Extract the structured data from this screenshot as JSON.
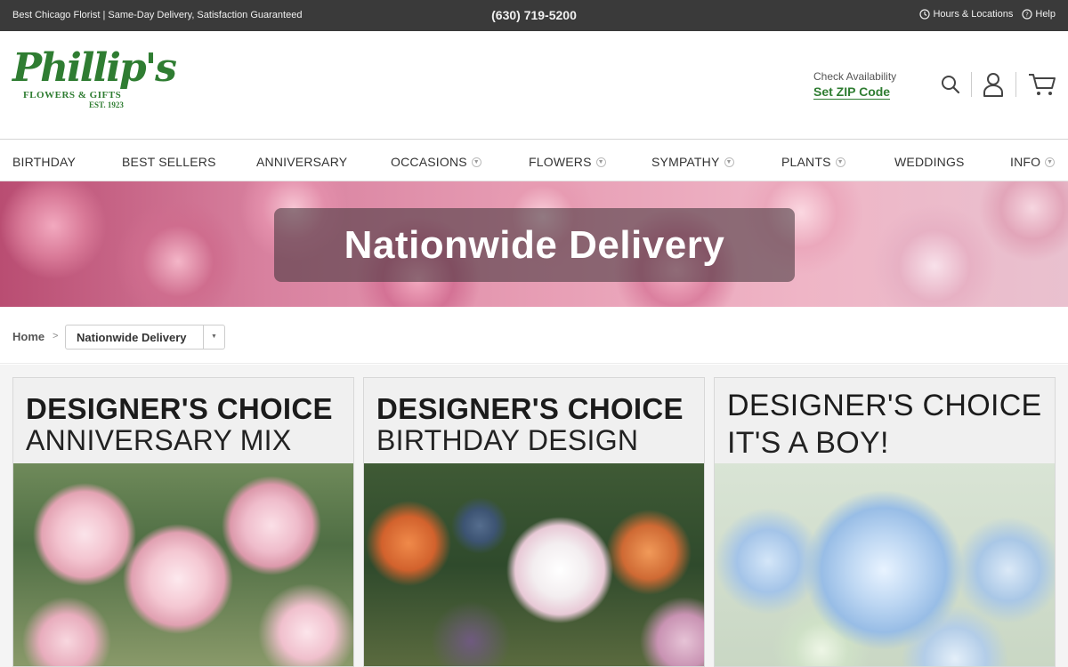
{
  "topbar": {
    "tagline": "Best Chicago Florist | Same-Day Delivery, Satisfaction Guaranteed",
    "phone": "(630) 719-5200",
    "hours_label": "Hours & Locations",
    "help_label": "Help"
  },
  "header": {
    "logo": {
      "script": "Phillip's",
      "sub": "FLOWERS & GIFTS",
      "est": "EST. 1923"
    },
    "zip": {
      "check_label": "Check Availability",
      "set_label": "Set ZIP Code"
    },
    "icons": [
      "search-icon",
      "user-icon",
      "cart-icon"
    ]
  },
  "nav": {
    "items": [
      {
        "label": "BIRTHDAY",
        "dropdown": false
      },
      {
        "label": "BEST SELLERS",
        "dropdown": false
      },
      {
        "label": "ANNIVERSARY",
        "dropdown": false
      },
      {
        "label": "OCCASIONS",
        "dropdown": true
      },
      {
        "label": "FLOWERS",
        "dropdown": true
      },
      {
        "label": "SYMPATHY",
        "dropdown": true
      },
      {
        "label": "PLANTS",
        "dropdown": true
      },
      {
        "label": "WEDDINGS",
        "dropdown": false
      },
      {
        "label": "INFO",
        "dropdown": true
      }
    ]
  },
  "banner": {
    "title": "Nationwide Delivery"
  },
  "breadcrumb": {
    "home": "Home",
    "separator": ">",
    "current": "Nationwide Delivery"
  },
  "products": [
    {
      "line1": "DESIGNER'S CHOICE",
      "line2": "ANNIVERSARY MIX"
    },
    {
      "line1": "DESIGNER'S CHOICE",
      "line2": "BIRTHDAY DESIGN"
    },
    {
      "line1": "DESIGNER'S CHOICE",
      "line2": "IT'S A BOY!"
    }
  ],
  "colors": {
    "brand_green": "#2f7d32",
    "topbar": "#3a3a3a"
  }
}
